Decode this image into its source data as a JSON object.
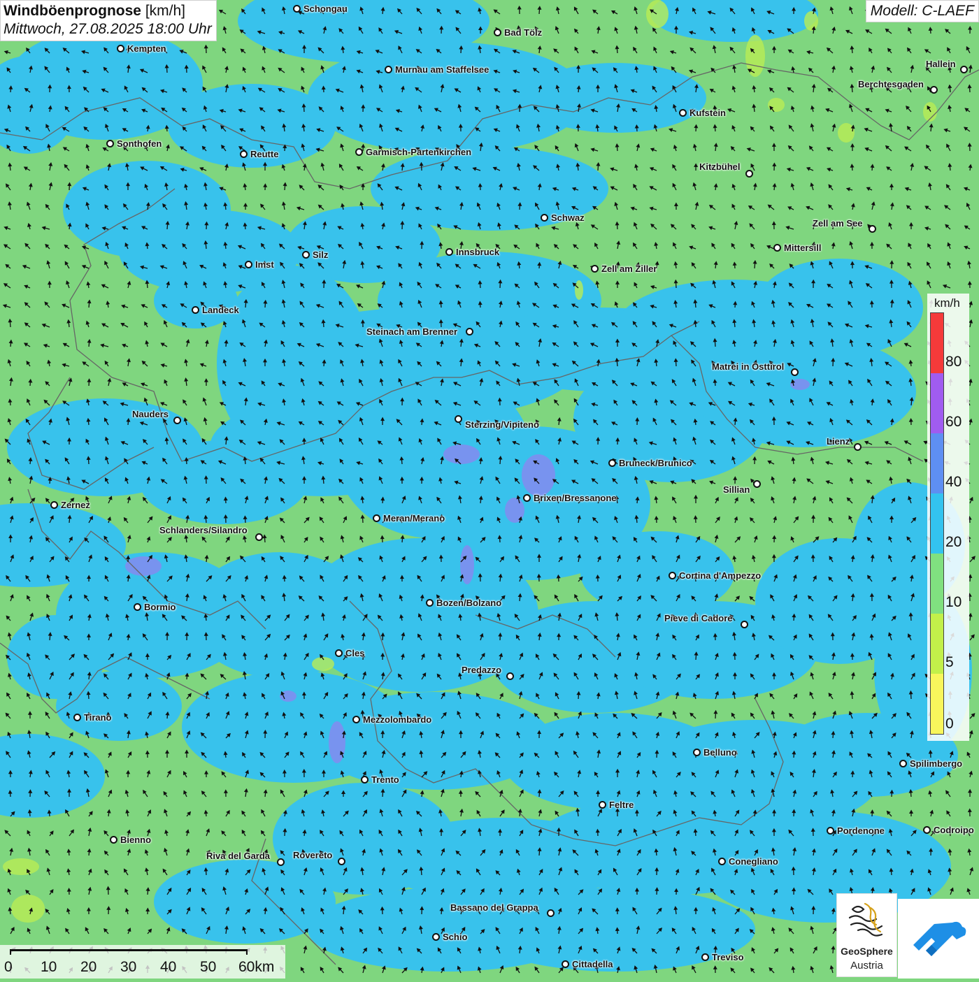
{
  "header": {
    "title_main": "Windböenprognose",
    "title_unit": "[km/h]",
    "datetime": "Mittwoch, 27.08.2025 18:00 Uhr",
    "model": "Modell: C-LAEF"
  },
  "legend": {
    "unit": "km/h",
    "levels": [
      "80",
      "60",
      "40",
      "20",
      "10",
      "5",
      "0"
    ],
    "colors": [
      "#f53a3a",
      "#a05cf0",
      "#5e8ff2",
      "#33c3ef",
      "#80e080",
      "#c2f04a",
      "#f8f65c"
    ]
  },
  "scale_bar": {
    "labels": [
      "0",
      "10",
      "20",
      "30",
      "40",
      "50",
      "60km"
    ]
  },
  "logos": {
    "geosphere_line1": "GeoSphere",
    "geosphere_line2": "Austria"
  },
  "colors": {
    "land_green": "#7fd67f",
    "wind_blue": "#38c2ec",
    "border_gray": "#666666"
  },
  "cities": [
    {
      "name": "Schongau"
    },
    {
      "name": "Bad Tölz"
    },
    {
      "name": "Kempten"
    },
    {
      "name": "Hallein"
    },
    {
      "name": "Murnau am Staffelsee"
    },
    {
      "name": "Berchtesgaden"
    },
    {
      "name": "Kufstein"
    },
    {
      "name": "Sonthofen"
    },
    {
      "name": "Reutte"
    },
    {
      "name": "Garmisch-Partenkirchen"
    },
    {
      "name": "Kitzbühel"
    },
    {
      "name": "Schwaz"
    },
    {
      "name": "Zell am See"
    },
    {
      "name": "Mittersill"
    },
    {
      "name": "Silz"
    },
    {
      "name": "Innsbruck"
    },
    {
      "name": "Imst"
    },
    {
      "name": "Zell am Ziller"
    },
    {
      "name": "Landeck"
    },
    {
      "name": "Steinach am Brenner"
    },
    {
      "name": "Matrei in Osttirol"
    },
    {
      "name": "Nauders"
    },
    {
      "name": "Sterzing/Vipiteno"
    },
    {
      "name": "Lienz"
    },
    {
      "name": "Bruneck/Brunico"
    },
    {
      "name": "Sillian"
    },
    {
      "name": "Zernez"
    },
    {
      "name": "Brixen/Bressanone"
    },
    {
      "name": "Meran/Merano"
    },
    {
      "name": "Schlanders/Silandro"
    },
    {
      "name": "Cortina d'Ampezzo"
    },
    {
      "name": "Bormio"
    },
    {
      "name": "Bozen/Bolzano"
    },
    {
      "name": "Pieve di Cadore"
    },
    {
      "name": "Cles"
    },
    {
      "name": "Predazzo"
    },
    {
      "name": "Tirano"
    },
    {
      "name": "Mezzolombardo"
    },
    {
      "name": "Belluno"
    },
    {
      "name": "Spilimbergo"
    },
    {
      "name": "Trento"
    },
    {
      "name": "Feltre"
    },
    {
      "name": "Pordenone"
    },
    {
      "name": "Codroipo"
    },
    {
      "name": "Bienno"
    },
    {
      "name": "Riva del Garda"
    },
    {
      "name": "Rovereto"
    },
    {
      "name": "Conegliano"
    },
    {
      "name": "Bassano del Grappa"
    },
    {
      "name": "Schio"
    },
    {
      "name": "Treviso"
    },
    {
      "name": "Cittadella"
    }
  ]
}
